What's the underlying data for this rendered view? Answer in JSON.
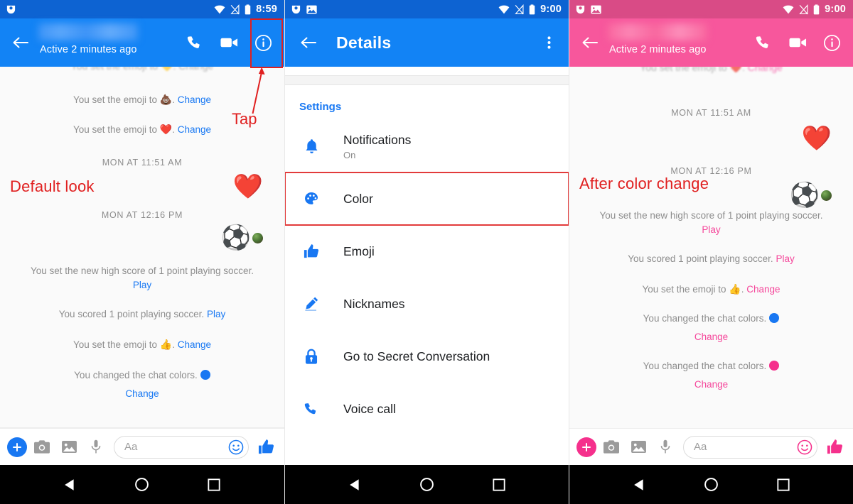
{
  "panels": {
    "left": {
      "status_bar": {
        "time": "8:59",
        "icons": [
          "app-notification-icon",
          "wifi-icon",
          "signal-off-icon",
          "battery-icon"
        ]
      },
      "app_bar": {
        "back_label": "back-arrow",
        "contact_name_blurred": "",
        "active_status": "Active 2 minutes ago",
        "actions": [
          "voice-call-icon",
          "video-call-icon",
          "info-icon"
        ]
      },
      "thread": {
        "cut_message": "You set the emoji to 💛. Change",
        "messages": [
          {
            "type": "system",
            "text": "You set the emoji to",
            "emoji": "💩",
            "suffix": ".",
            "link": "Change"
          },
          {
            "type": "system",
            "text": "You set the emoji to",
            "emoji": "❤️",
            "suffix": ".",
            "link": "Change"
          },
          {
            "type": "daystamp",
            "text": "MON AT 11:51 AM"
          },
          {
            "type": "sticker",
            "emoji": "❤️"
          },
          {
            "type": "daystamp",
            "text": "MON AT 12:16 PM"
          },
          {
            "type": "sticker",
            "emoji": "⚽"
          },
          {
            "type": "system",
            "text": "You set the new high score of 1 point playing soccer.",
            "link": "Play"
          },
          {
            "type": "system",
            "text": "You scored 1 point playing soccer.",
            "link": "Play"
          },
          {
            "type": "system",
            "text": "You set the emoji to",
            "emoji": "👍",
            "suffix": ".",
            "link": "Change"
          },
          {
            "type": "system",
            "text": "You changed the chat colors.",
            "swatch": "#1877f2",
            "link": "Change"
          }
        ]
      },
      "annotation": {
        "label": "Default look"
      },
      "composer": {
        "plus": "add-icon",
        "camera": "camera-icon",
        "gallery": "gallery-icon",
        "mic": "microphone-icon",
        "placeholder": "Aa",
        "sticker": "smiley-icon",
        "like": "thumbs-up-icon"
      },
      "theme": {
        "status_bar": "#0d63d2",
        "app_bar": "#1283f5",
        "accent": "#1877f2",
        "link": "#1878f3"
      }
    },
    "middle": {
      "status_bar": {
        "time": "9:00",
        "icons": [
          "app-notification-icon",
          "image-icon",
          "wifi-icon",
          "signal-off-icon",
          "battery-icon"
        ]
      },
      "app_bar": {
        "title": "Details",
        "overflow": "more-options-icon"
      },
      "section_header": "Settings",
      "rows": [
        {
          "label": "Notifications",
          "sub": "On",
          "icon": "bell-icon",
          "highlighted": false
        },
        {
          "label": "Color",
          "sub": "",
          "icon": "palette-icon",
          "highlighted": true
        },
        {
          "label": "Emoji",
          "sub": "",
          "icon": "thumbs-up-icon",
          "highlighted": false
        },
        {
          "label": "Nicknames",
          "sub": "",
          "icon": "pencil-icon",
          "highlighted": false
        },
        {
          "label": "Go to Secret Conversation",
          "sub": "",
          "icon": "lock-icon",
          "highlighted": false
        },
        {
          "label": "Voice call",
          "sub": "",
          "icon": "phone-icon",
          "highlighted": false
        }
      ],
      "theme": {
        "status_bar": "#0d63d2",
        "app_bar": "#1283f5",
        "accent": "#1877f2"
      }
    },
    "right": {
      "status_bar": {
        "time": "9:00",
        "icons": [
          "app-notification-icon",
          "image-icon",
          "wifi-icon",
          "signal-off-icon",
          "battery-icon"
        ]
      },
      "app_bar": {
        "contact_name_blurred": "",
        "active_status": "Active 2 minutes ago",
        "actions": [
          "voice-call-icon",
          "video-call-icon",
          "info-icon"
        ]
      },
      "thread": {
        "cut_message_prefix": "You set the emoji to",
        "cut_message_emoji": "❤️",
        "cut_message_suffix": ".",
        "cut_message_link": "Change",
        "messages": [
          {
            "type": "daystamp",
            "text": "MON AT 11:51 AM"
          },
          {
            "type": "sticker",
            "emoji": "❤️"
          },
          {
            "type": "daystamp",
            "text": "MON AT 12:16 PM"
          },
          {
            "type": "sticker",
            "emoji": "⚽"
          },
          {
            "type": "system",
            "text": "You set the new high score of 1 point playing soccer.",
            "link": "Play"
          },
          {
            "type": "system",
            "text": "You scored 1 point playing soccer.",
            "link": "Play"
          },
          {
            "type": "system",
            "text": "You set the emoji to",
            "emoji": "👍",
            "suffix": ".",
            "link": "Change"
          },
          {
            "type": "system",
            "text": "You changed the chat colors.",
            "swatch": "#1877f2",
            "link": "Change"
          },
          {
            "type": "system",
            "text": "You changed the chat colors.",
            "swatch": "#f5308c",
            "link": "Change"
          }
        ]
      },
      "annotation": {
        "label": "After color change"
      },
      "composer": {
        "placeholder": "Aa"
      },
      "theme": {
        "status_bar": "#d94b86",
        "app_bar": "#f7579c",
        "accent": "#f5308c",
        "link": "#f5479b"
      }
    }
  },
  "annotations": {
    "tap_label": "Tap",
    "color": "#e02020"
  }
}
